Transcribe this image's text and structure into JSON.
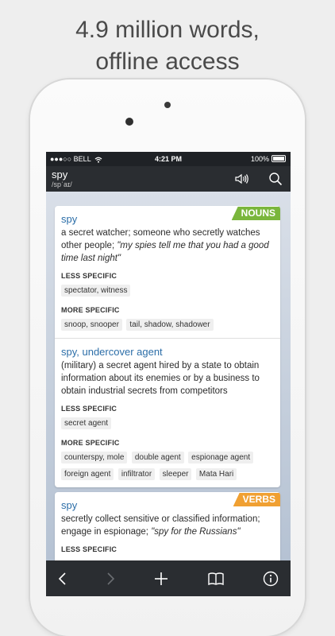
{
  "headline": {
    "line1": "4.9 million words,",
    "line2": "offline access"
  },
  "status": {
    "carrier": "●●●○○ BELL",
    "time": "4:21 PM",
    "battery": "100%"
  },
  "entry": {
    "word": "spy",
    "pronunciation": "/spˈaɪ/"
  },
  "nouns_card": {
    "badge": "NOUNS",
    "senses": [
      {
        "headword": "spy",
        "definition": "a secret watcher; someone who secretly watches other people; ",
        "example": "\"my spies tell me that you had a good time last night\"",
        "less_specific_label": "LESS SPECIFIC",
        "less_specific": [
          "spectator, witness"
        ],
        "more_specific_label": "MORE SPECIFIC",
        "more_specific": [
          "snoop, snooper",
          "tail, shadow, shadower"
        ]
      },
      {
        "headword": "spy, undercover agent",
        "definition": "(military) a secret agent hired by a state to obtain information about its enemies or by a business to obtain industrial secrets from competitors",
        "less_specific_label": "LESS SPECIFIC",
        "less_specific": [
          "secret agent"
        ],
        "more_specific_label": "MORE SPECIFIC",
        "more_specific": [
          "counterspy, mole",
          "double agent",
          "espionage agent",
          "foreign agent",
          "infiltrator",
          "sleeper",
          "Mata Hari"
        ]
      }
    ]
  },
  "verbs_card": {
    "badge": "VERBS",
    "headword": "spy",
    "definition": "secretly collect sensitive or classified information; engage in espionage; ",
    "example": "\"spy for the Russians\"",
    "less_specific_label": "LESS SPECIFIC"
  },
  "icons": {
    "speaker": "speaker-icon",
    "search": "search-icon",
    "back": "chevron-left-icon",
    "forward": "chevron-right-icon",
    "add": "plus-icon",
    "bookmarks": "book-icon",
    "info": "info-icon"
  },
  "colors": {
    "nouns": "#7ab63c",
    "verbs": "#f0a032",
    "link": "#2c6ea8",
    "bar": "#2a2d31"
  }
}
